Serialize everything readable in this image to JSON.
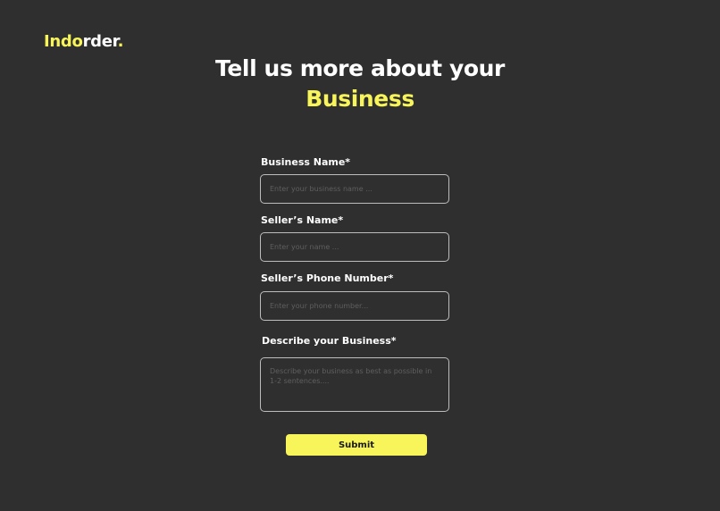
{
  "brand": {
    "accent_part": "Indo",
    "rest_part": "rder",
    "dot": "."
  },
  "headline": {
    "line1": "Tell us more about your",
    "line2": "Business"
  },
  "form": {
    "business_name": {
      "label": "Business Name*",
      "placeholder": "Enter your business name ...",
      "value": ""
    },
    "seller_name": {
      "label": "Seller’s Name*",
      "placeholder": "Enter your name ...",
      "value": ""
    },
    "seller_phone": {
      "label": "Seller’s Phone Number*",
      "placeholder": "Enter your phone number...",
      "value": ""
    },
    "business_description": {
      "label": "Describe your Business*",
      "placeholder": "Describe your business as best as possible in 1-2 sentences....",
      "value": ""
    },
    "submit_label": "Submit"
  },
  "colors": {
    "background": "#2f2f2f",
    "accent": "#f7f55a",
    "text": "#ffffff",
    "input_border": "#bdbdbd"
  }
}
